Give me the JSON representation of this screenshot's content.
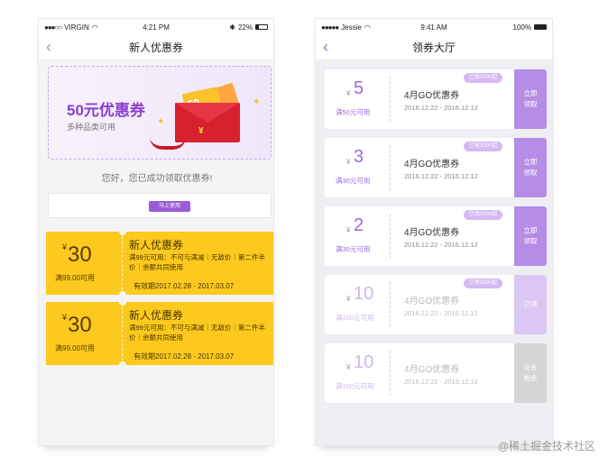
{
  "left": {
    "status": {
      "carrier": "VIRGIN",
      "time": "4:21 PM",
      "battery": "22%"
    },
    "nav_title": "新人优惠券",
    "banner": {
      "big": "50元优惠券",
      "small": "多种品类可用",
      "card_text": "50",
      "yen": "¥"
    },
    "success": "您好，您已成功领取优惠券!",
    "use_button": "马上使用",
    "coupons": [
      {
        "yen": "¥",
        "amount": "30",
        "condition": "满99.00可用",
        "title": "新人优惠券",
        "desc": "满99元可用：不可与满减｜无敌价｜第二件半价｜余额共同使用",
        "valid": "有效期2017.02.28 - 2017.03.07"
      },
      {
        "yen": "¥",
        "amount": "30",
        "condition": "满99.00可用",
        "title": "新人优惠券",
        "desc": "满99元可用：不可与满减｜无敌价｜第二件半价｜余额共同使用",
        "valid": "有效期2017.02.28 - 2017.03.07"
      }
    ]
  },
  "right": {
    "status": {
      "carrier": "Jessie",
      "time": "9:41 AM",
      "battery": "100%"
    },
    "nav_title": "领券大厅",
    "tickets": [
      {
        "yen": "¥",
        "amount": "5",
        "condition": "满50元可用",
        "name": "4月GO优惠券",
        "date": "2016.12.22 - 2016.12.12",
        "tag": "已抢2000起",
        "action": "立即领取",
        "state": "active"
      },
      {
        "yen": "¥",
        "amount": "3",
        "condition": "满30元可用",
        "name": "4月GO优惠券",
        "date": "2016.12.22 - 2016.12.12",
        "tag": "已抢2000起",
        "action": "立即领取",
        "state": "active"
      },
      {
        "yen": "¥",
        "amount": "2",
        "condition": "满30元可用",
        "name": "4月GO优惠券",
        "date": "2016.12.22 - 2016.12.12",
        "tag": "已抢2000起",
        "action": "立即领取",
        "state": "active"
      },
      {
        "yen": "¥",
        "amount": "10",
        "condition": "满100元可用",
        "name": "4月GO优惠券",
        "date": "2016.12.22 - 2016.12.12",
        "tag": "已抢2000起",
        "action": "已领",
        "state": "used"
      },
      {
        "yen": "¥",
        "amount": "10",
        "condition": "满100元可用",
        "name": "4月GO优惠券",
        "date": "2016.12.22 - 2016.12.12",
        "tag": "",
        "action": "没有剩余",
        "state": "gone"
      }
    ]
  },
  "watermark": "@稀土掘金技术社区",
  "colors": {
    "purple": "#9a5bd8",
    "yellow": "#fcca1e"
  }
}
